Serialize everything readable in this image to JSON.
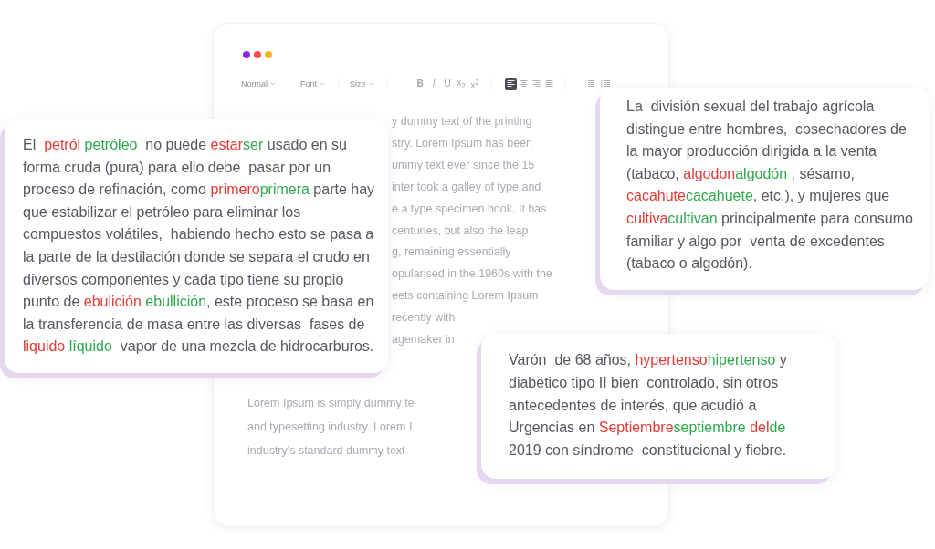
{
  "editor": {
    "window_dots": [
      {
        "color": "#8a2be2"
      },
      {
        "color": "#ff4d4f"
      },
      {
        "color": "#ffb020"
      }
    ],
    "toolbar": {
      "dropdowns": [
        "Normal",
        "Font",
        "Size"
      ],
      "format_buttons": [
        {
          "label": "B",
          "kind": "bold"
        },
        {
          "label": "I",
          "kind": "italic"
        },
        {
          "label": "U",
          "kind": "underline"
        },
        {
          "label": "x$_{2}$",
          "kind": "plain"
        },
        {
          "label": "x$^{2}$",
          "kind": "plain"
        }
      ],
      "align_buttons": [
        {
          "kind": "left",
          "selected": true
        },
        {
          "kind": "center",
          "selected": false
        },
        {
          "kind": "right",
          "selected": false
        },
        {
          "kind": "justify",
          "selected": false
        }
      ],
      "list_buttons": [
        {
          "kind": "bullets"
        },
        {
          "kind": "numbers"
        }
      ]
    },
    "background_text_top": [
      "y dummy text of the printing",
      "stry. Lorem Ipsum has been",
      "ummy text ever since the 15",
      "inter took a galley of type and",
      "e a type specimen book. It has",
      "centuries, but also the leap",
      "g, remaining essentially",
      "opularised in the 1960s with the",
      "eets containing Lorem Ipsum",
      "recently with",
      "agemaker in"
    ],
    "background_text_bottom": [
      "Lorem Ipsum is simply dummy te",
      "and typesetting industry. Lorem I",
      "industry's standard dummy text"
    ]
  },
  "cards": [
    {
      "segments": [
        {
          "kind": "plain",
          "text": "El  "
        },
        {
          "kind": "error",
          "text": "petról"
        },
        {
          "kind": "correction",
          "text": " petróleo"
        },
        {
          "kind": "plain",
          "text": "  no puede "
        },
        {
          "kind": "error",
          "text": "estar"
        },
        {
          "kind": "correction",
          "text": "ser"
        },
        {
          "kind": "plain",
          "text": " usado en su forma cruda (pura) para ello debe  pasar por un proceso de refinación, como "
        },
        {
          "kind": "error",
          "text": "primero"
        },
        {
          "kind": "correction",
          "text": "primera"
        },
        {
          "kind": "plain",
          "text": " parte hay  que estabilizar el petróleo para eliminar los compuestos volátiles,  habiendo hecho esto se pasa a la parte de la destilación donde se separa el crudo en diversos componentes y cada tipo tiene su propio  punto de "
        },
        {
          "kind": "error",
          "text": "ebulición"
        },
        {
          "kind": "correction",
          "text": " ebullición"
        },
        {
          "kind": "plain",
          "text": ", este proceso se basa en la transferencia de masa entre las diversas  fases de "
        },
        {
          "kind": "error",
          "text": "liquido"
        },
        {
          "kind": "correction",
          "text": " líquido"
        },
        {
          "kind": "plain",
          "text": "  vapor de una mezcla de hidrocarburos."
        }
      ]
    },
    {
      "segments": [
        {
          "kind": "plain",
          "text": "La  división sexual del trabajo agrícola distingue entre hombres,  cosechadores de la mayor producción dirigida a la venta (tabaco, "
        },
        {
          "kind": "error",
          "text": "algodon"
        },
        {
          "kind": "correction",
          "text": "algodón"
        },
        {
          "kind": "plain",
          "text": " , sésamo, "
        },
        {
          "kind": "error",
          "text": "cacahute"
        },
        {
          "kind": "correction",
          "text": "cacahuete"
        },
        {
          "kind": "plain",
          "text": ", etc.), y mujeres que "
        },
        {
          "kind": "error",
          "text": "cultiva"
        },
        {
          "kind": "correction",
          "text": "cultivan"
        },
        {
          "kind": "plain",
          "text": " principalmente para consumo familiar y algo por  venta de excedentes (tabaco o algodón)."
        }
      ]
    },
    {
      "segments": [
        {
          "kind": "plain",
          "text": "Varón  de 68 años, "
        },
        {
          "kind": "error",
          "text": "hypertenso"
        },
        {
          "kind": "correction",
          "text": "hipertenso"
        },
        {
          "kind": "plain",
          "text": " y diabético tipo II bien  controlado, sin otros antecedentes de interés, que acudió a Urgencias en "
        },
        {
          "kind": "error",
          "text": "Septiembre"
        },
        {
          "kind": "correction",
          "text": "septiembre"
        },
        {
          "kind": "error",
          "text": " del"
        },
        {
          "kind": "correction",
          "text": "de"
        },
        {
          "kind": "plain",
          "text": " 2019 con síndrome  constitucional y fiebre."
        }
      ]
    }
  ]
}
